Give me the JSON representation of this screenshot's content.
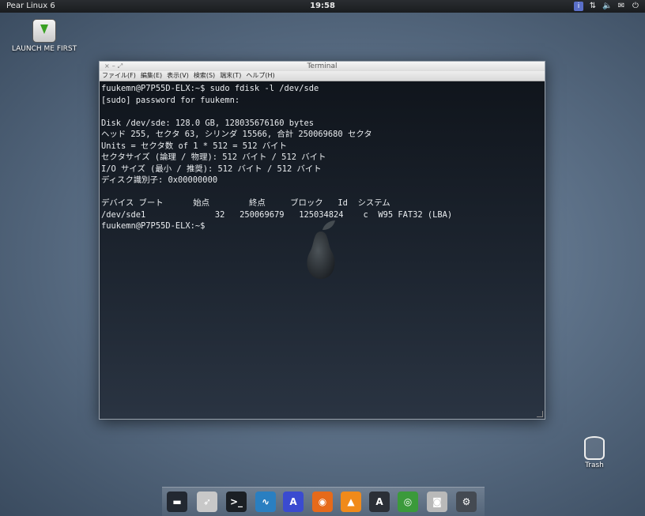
{
  "top_panel": {
    "os_label": "Pear Linux 6",
    "clock": "19:58",
    "tray_icons": [
      "keyboard-layout-icon",
      "network-arrows-icon",
      "volume-icon",
      "mail-icon",
      "power-icon"
    ]
  },
  "desktop": {
    "launch_label": "LAUNCH ME FIRST",
    "trash_label": "Trash"
  },
  "window": {
    "title": "Terminal",
    "menu": [
      "ファイル(F)",
      "編集(E)",
      "表示(V)",
      "検索(S)",
      "端末(T)",
      "ヘルプ(H)"
    ],
    "lines": [
      "fuukemn@P7P55D-ELX:~$ sudo fdisk -l /dev/sde",
      "[sudo] password for fuukemn:",
      "",
      "Disk /dev/sde: 128.0 GB, 128035676160 bytes",
      "ヘッド 255, セクタ 63, シリンダ 15566, 合計 250069680 セクタ",
      "Units = セクタ数 of 1 * 512 = 512 バイト",
      "セクタサイズ (論理 / 物理): 512 バイト / 512 バイト",
      "I/O サイズ (最小 / 推奨): 512 バイト / 512 バイト",
      "ディスク識別子: 0x00000000",
      "",
      "デバイス ブート      始点        終点     ブロック   Id  システム",
      "/dev/sde1              32   250069679   125034824    c  W95 FAT32 (LBA)",
      "fuukemn@P7P55D-ELX:~$"
    ]
  },
  "dock": {
    "items": [
      {
        "name": "monitor-icon",
        "color": "#222831",
        "glyph": "▬"
      },
      {
        "name": "rocket-icon",
        "color": "#c8c8c8",
        "glyph": "➶"
      },
      {
        "name": "terminal-icon",
        "color": "#1b1f24",
        "glyph": ">_"
      },
      {
        "name": "system-monitor-icon",
        "color": "#2a7fc1",
        "glyph": "∿"
      },
      {
        "name": "font-viewer-icon",
        "color": "#3a4bd0",
        "glyph": "A"
      },
      {
        "name": "firefox-icon",
        "color": "#e66a1a",
        "glyph": "◉"
      },
      {
        "name": "vlc-icon",
        "color": "#f08a1a",
        "glyph": "▲"
      },
      {
        "name": "app-store-icon",
        "color": "#2b2f36",
        "glyph": "A"
      },
      {
        "name": "network-globe-icon",
        "color": "#3b9a3b",
        "glyph": "◎"
      },
      {
        "name": "camera-icon",
        "color": "#b9b9b9",
        "glyph": "◙"
      },
      {
        "name": "settings-icon",
        "color": "#444a52",
        "glyph": "⚙"
      }
    ]
  }
}
